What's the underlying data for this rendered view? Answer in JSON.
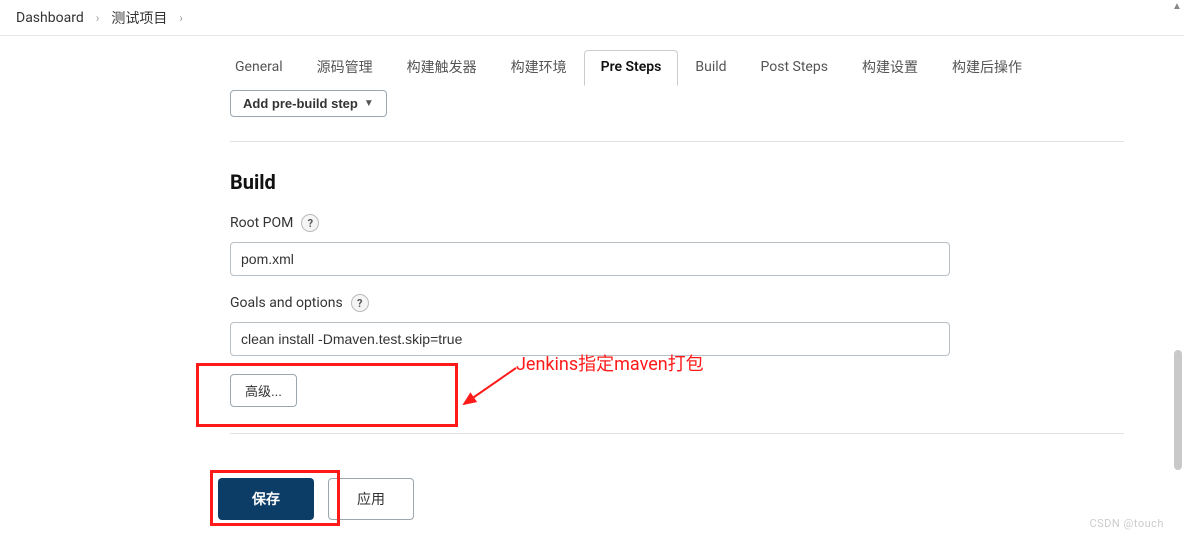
{
  "breadcrumb": {
    "items": [
      "Dashboard",
      "测试项目"
    ],
    "sep": "›"
  },
  "tabs": {
    "items": [
      {
        "label": "General"
      },
      {
        "label": "源码管理"
      },
      {
        "label": "构建触发器"
      },
      {
        "label": "构建环境"
      },
      {
        "label": "Pre Steps",
        "active": true
      },
      {
        "label": "Build"
      },
      {
        "label": "Post Steps"
      },
      {
        "label": "构建设置"
      },
      {
        "label": "构建后操作"
      }
    ]
  },
  "add_step_label": "Add pre-build step",
  "build": {
    "title": "Build",
    "root_pom": {
      "label": "Root POM",
      "value": "pom.xml"
    },
    "goals": {
      "label": "Goals and options",
      "value": "clean install -Dmaven.test.skip=true"
    },
    "advanced_label": "高级..."
  },
  "footer": {
    "save": "保存",
    "apply": "应用"
  },
  "annotation": {
    "text": "Jenkins指定maven打包"
  },
  "help_glyph": "?",
  "watermark": "CSDN @touch"
}
